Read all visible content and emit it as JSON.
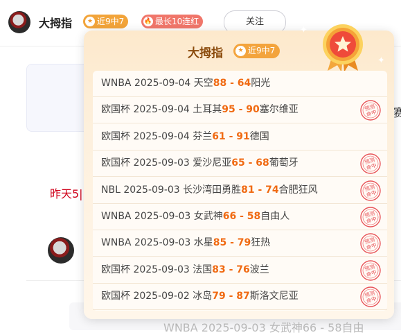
{
  "header": {
    "username": "大拇指",
    "badge_streak": "近9中7",
    "badge_best": "最长10连红",
    "follow_label": "关注"
  },
  "background": {
    "edge_char": "赛",
    "yesterday_text": "昨天5|",
    "bottom_text": "WNBA 2025-09-03 女武神66 - 58自由"
  },
  "popup": {
    "title": "大拇指",
    "tag": "近9中7",
    "stamp_text": "预测命中",
    "rows": [
      {
        "league": "WNBA",
        "date": "2025-09-04",
        "home": "天空",
        "home_score": "88",
        "away_score": "64",
        "away": "阳光",
        "hit": false
      },
      {
        "league": "欧国杯",
        "date": "2025-09-04",
        "home": "土耳其",
        "home_score": "95",
        "away_score": "90",
        "away": "塞尔维亚",
        "hit": true
      },
      {
        "league": "欧国杯",
        "date": "2025-09-04",
        "home": "芬兰",
        "home_score": "61",
        "away_score": "91",
        "away": "德国",
        "hit": false
      },
      {
        "league": "欧国杯",
        "date": "2025-09-03",
        "home": "爱沙尼亚",
        "home_score": "65",
        "away_score": "68",
        "away": "葡萄牙",
        "hit": true
      },
      {
        "league": "NBL",
        "date": "2025-09-03",
        "home": "长沙湾田勇胜",
        "home_score": "81",
        "away_score": "74",
        "away": "合肥狂风",
        "hit": true
      },
      {
        "league": "WNBA",
        "date": "2025-09-03",
        "home": "女武神",
        "home_score": "66",
        "away_score": "58",
        "away": "自由人",
        "hit": true
      },
      {
        "league": "WNBA",
        "date": "2025-09-03",
        "home": "水星",
        "home_score": "85",
        "away_score": "79",
        "away": "狂热",
        "hit": true
      },
      {
        "league": "欧国杯",
        "date": "2025-09-03",
        "home": "法国",
        "home_score": "83",
        "away_score": "76",
        "away": "波兰",
        "hit": true
      },
      {
        "league": "欧国杯",
        "date": "2025-09-02",
        "home": "冰岛",
        "home_score": "79",
        "away_score": "87",
        "away": "斯洛文尼亚",
        "hit": true
      }
    ]
  },
  "colors": {
    "score": "#f06a12",
    "stamp": "#e8555a",
    "badge_orange": "#f2a43a",
    "badge_red": "#f0766a",
    "title_brown": "#8a4a0b"
  }
}
